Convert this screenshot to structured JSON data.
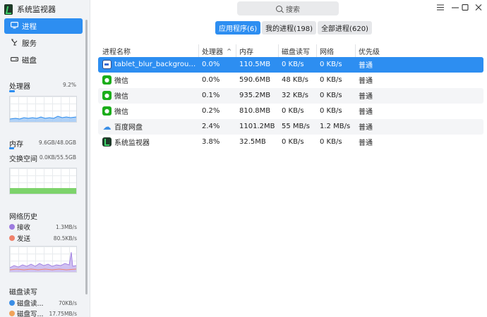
{
  "app": {
    "title": "系统监视器"
  },
  "nav": [
    {
      "label": "进程",
      "icon": "monitor-icon",
      "active": true
    },
    {
      "label": "服务",
      "icon": "service-icon",
      "active": false
    },
    {
      "label": "磁盘",
      "icon": "disk-icon",
      "active": false
    }
  ],
  "cpu": {
    "title": "处理器",
    "value": "9.2%",
    "usage_fraction": 0.092
  },
  "memory": {
    "title": "内存",
    "value": "9.6GB/48.0GB",
    "usage_fraction": 0.2,
    "swap_title": "交换空间",
    "swap_value": "0.0KB/55.5GB"
  },
  "network": {
    "title": "网络历史",
    "recv_label": "接收",
    "recv_value": "1.3MB/s",
    "send_label": "发送",
    "send_value": "80.5KB/s"
  },
  "disk": {
    "title": "磁盘读写",
    "read_label": "磁盘读...",
    "read_value": "70KB/s",
    "write_label": "磁盘写...",
    "write_value": "17.75MB/s"
  },
  "search": {
    "placeholder": "搜索"
  },
  "tabs": [
    {
      "label": "应用程序(6)",
      "active": true
    },
    {
      "label": "我的进程(198)",
      "active": false
    },
    {
      "label": "全部进程(620)",
      "active": false
    }
  ],
  "table": {
    "headers": {
      "name": "进程名称",
      "cpu": "处理器",
      "sort": "^",
      "mem": "内存",
      "disk": "磁盘读写",
      "net": "网络",
      "pri": "优先级"
    },
    "rows": [
      {
        "icon": "tablet-icon",
        "name": "tablet_blur_background — ...",
        "cpu": "0.0%",
        "mem": "110.5MB",
        "disk": "0 KB/s",
        "net": "0 KB/s",
        "pri": "普通"
      },
      {
        "icon": "wechat-icon",
        "name": "微信",
        "cpu": "0.0%",
        "mem": "590.6MB",
        "disk": "48 KB/s",
        "net": "0 KB/s",
        "pri": "普通"
      },
      {
        "icon": "wechat-icon",
        "name": "微信",
        "cpu": "0.1%",
        "mem": "935.2MB",
        "disk": "32 KB/s",
        "net": "0 KB/s",
        "pri": "普通"
      },
      {
        "icon": "wechat-icon",
        "name": "微信",
        "cpu": "0.2%",
        "mem": "810.8MB",
        "disk": "0 KB/s",
        "net": "0 KB/s",
        "pri": "普通"
      },
      {
        "icon": "baidu-netdisk-icon",
        "name": "百度网盘",
        "cpu": "2.4%",
        "mem": "1101.2MB",
        "disk": "55 MB/s",
        "net": "1.2 MB/s",
        "pri": "普通"
      },
      {
        "icon": "system-monitor-icon",
        "name": "系统监视器",
        "cpu": "3.8%",
        "mem": "32.5MB",
        "disk": "0 KB/s",
        "net": "0 KB/s",
        "pri": "普通"
      }
    ]
  },
  "colors": {
    "accent": "#2d8ef1",
    "swap_bar": "#7dd36b",
    "recv": "#9d7be0",
    "send": "#f0826b",
    "disk_read": "#3a8ee6",
    "disk_write": "#f0a35a"
  }
}
